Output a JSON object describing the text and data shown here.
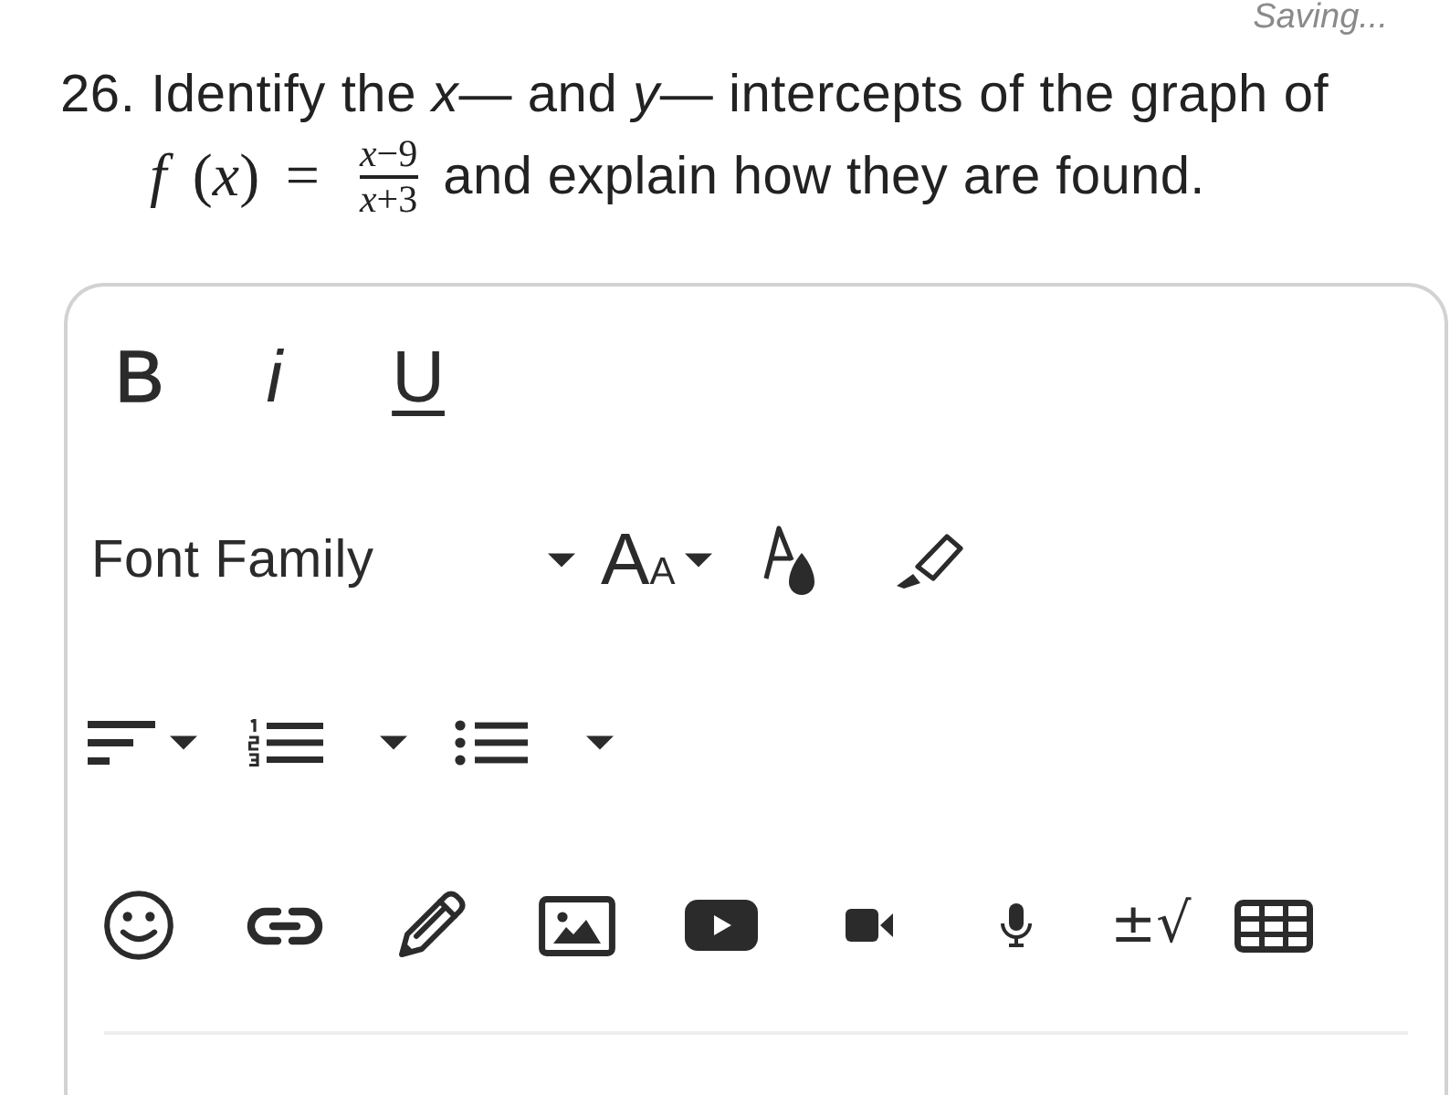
{
  "status": "Saving...",
  "question": {
    "text": "26. Identify the *x*— and *y*— intercepts of the graph of",
    "formula": {
      "lhs": "*f* (*x*) =",
      "numerator": "*x*−9",
      "denominator": "*x*+3"
    },
    "text_after": "and explain how they are found."
  },
  "toolbar": {
    "groups": [
      {
        "tools": [
          {
            "kind": "bold",
            "label": "B"
          },
          {
            "kind": "italic",
            "label": "i"
          },
          {
            "kind": "underline",
            "label": "U"
          }
        ]
      },
      {
        "tools": [
          {
            "kind": "font_family",
            "label": "Font Family"
          },
          {
            "kind": "font_size",
            "label_large": "A",
            "label_small": "A"
          },
          {
            "kind": "font_color"
          },
          {
            "kind": "highlight"
          }
        ]
      },
      {
        "tools": [
          {
            "kind": "align"
          },
          {
            "kind": "numbered_list"
          },
          {
            "kind": "bulleted_list"
          }
        ]
      },
      {
        "tools": [
          {
            "kind": "emoji"
          },
          {
            "kind": "link"
          },
          {
            "kind": "draw"
          },
          {
            "kind": "image"
          },
          {
            "kind": "video"
          },
          {
            "kind": "record_video"
          },
          {
            "kind": "record_audio"
          },
          {
            "kind": "equation",
            "label": "±√"
          },
          {
            "kind": "table"
          }
        ]
      }
    ]
  }
}
